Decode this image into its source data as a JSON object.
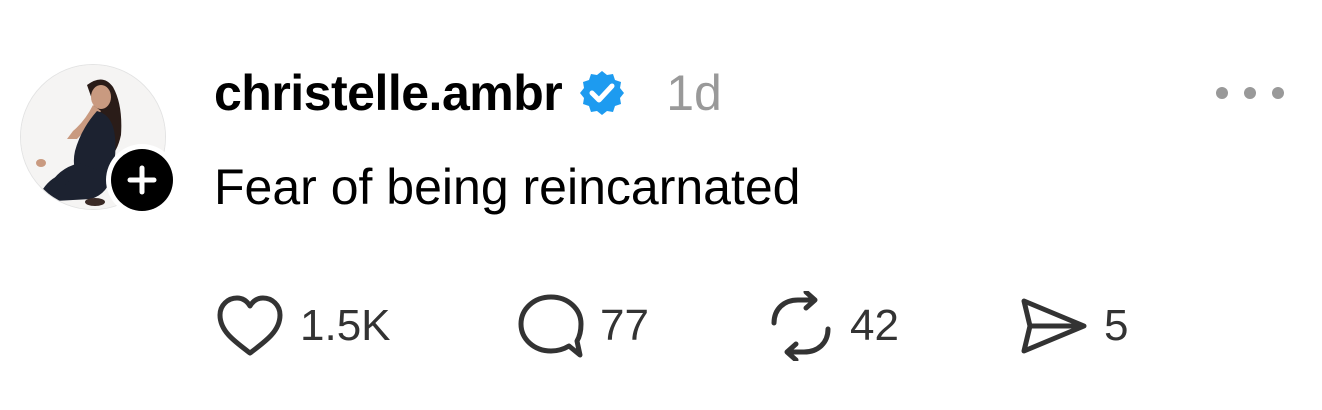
{
  "post": {
    "author": {
      "username": "christelle.ambr",
      "verified_icon": "verified-badge-icon",
      "verified_color": "#1d9bf0",
      "avatar_icon": "avatar"
    },
    "time": "1d",
    "text": "Fear of being reincarnated",
    "follow_icon": "plus-icon",
    "more_icon": "more-icon",
    "actions": {
      "like": {
        "icon": "heart-icon",
        "count": "1.5K"
      },
      "reply": {
        "icon": "comment-icon",
        "count": "77"
      },
      "repost": {
        "icon": "repost-icon",
        "count": "42"
      },
      "share": {
        "icon": "send-icon",
        "count": "5"
      }
    }
  }
}
